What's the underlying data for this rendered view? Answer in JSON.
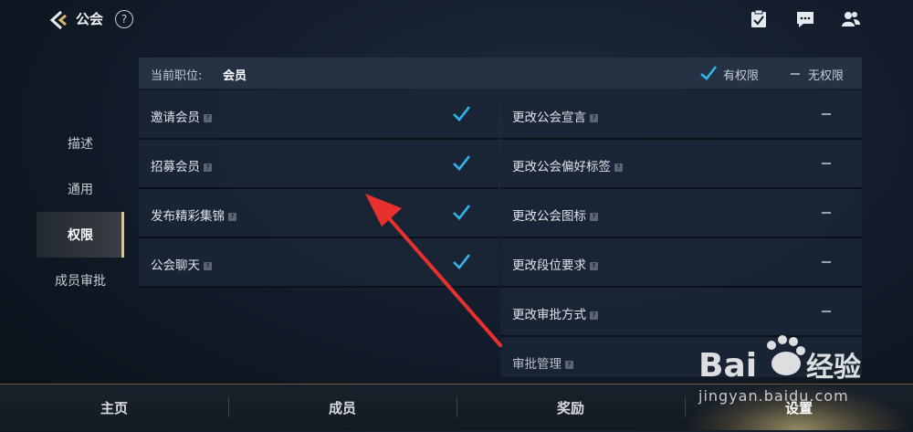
{
  "header": {
    "title": "公会",
    "help_glyph": "?"
  },
  "sidebar": {
    "items": [
      {
        "label": "描述"
      },
      {
        "label": "通用"
      },
      {
        "label": "权限"
      },
      {
        "label": "成员审批"
      }
    ],
    "active_index": 2
  },
  "permissions": {
    "header_label": "当前职位:",
    "role": "会员",
    "legend_has": "有权限",
    "legend_none": "无权限",
    "left": [
      {
        "label": "邀请会员",
        "granted": true
      },
      {
        "label": "招募会员",
        "granted": true
      },
      {
        "label": "发布精彩集锦",
        "granted": true
      },
      {
        "label": "公会聊天",
        "granted": true
      }
    ],
    "right": [
      {
        "label": "更改公会宣言",
        "granted": false
      },
      {
        "label": "更改公会偏好标签",
        "granted": false
      },
      {
        "label": "更改公会图标",
        "granted": false
      },
      {
        "label": "更改段位要求",
        "granted": false
      },
      {
        "label": "更改审批方式",
        "granted": false
      },
      {
        "label": "审批管理",
        "granted": false
      }
    ]
  },
  "bottom_nav": {
    "tabs": [
      {
        "label": "主页"
      },
      {
        "label": "成员"
      },
      {
        "label": "奖励"
      },
      {
        "label": "设置"
      }
    ],
    "active_index": 3
  },
  "watermark": {
    "brand": "Bai du 经验",
    "url": "jingyan.baidu.com"
  },
  "colors": {
    "accent_gold": "#e8c36b",
    "check_blue": "#2fb6ea",
    "annotation_red": "#e8312f"
  }
}
